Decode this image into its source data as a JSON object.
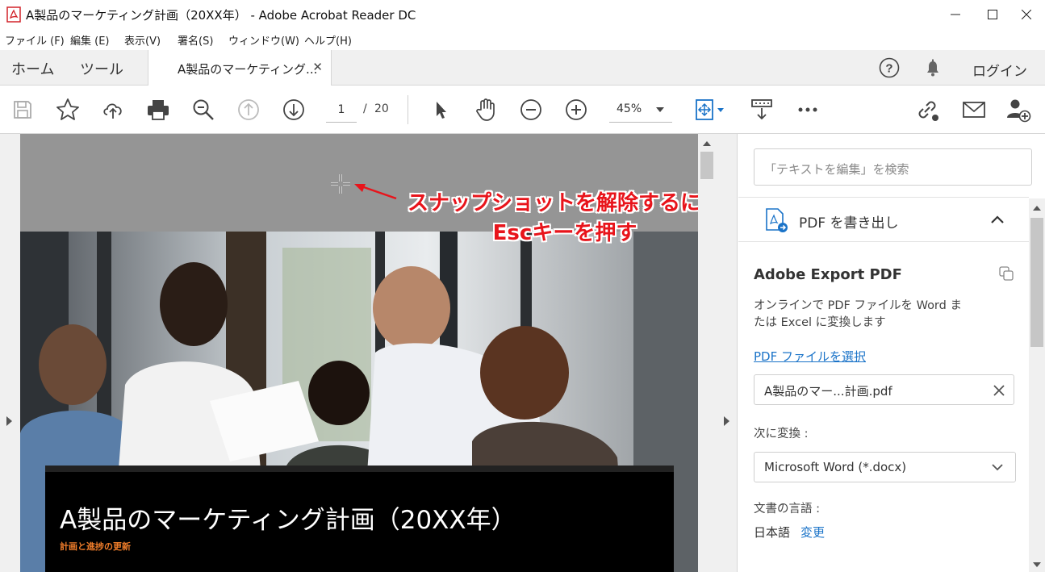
{
  "window": {
    "title": "A製品のマーケティング計画（20XX年） - Adobe Acrobat Reader DC"
  },
  "menu": {
    "items": [
      "ファイル (F)",
      "編集 (E)",
      "表示(V)",
      "署名(S)",
      "ウィンドウ(W)",
      "ヘルプ(H)"
    ]
  },
  "tabs": {
    "home": "ホーム",
    "tools": "ツール",
    "document": "A製品のマーケティング...",
    "login": "ログイン"
  },
  "toolbar": {
    "page_current": "1",
    "page_sep": "/",
    "page_total": "20",
    "zoom": "45%"
  },
  "annotation": {
    "line1": "スナップショットを解除するには",
    "line2": "Escキーを押す",
    "color": "#e8141b"
  },
  "document": {
    "title": "A製品のマーケティング計画（20XX年）",
    "subtitle": "計画と進捗の更新",
    "subtitle_color": "#f07d2a"
  },
  "panel": {
    "search_placeholder": "「テキストを編集」を検索",
    "export_section": "PDF を書き出し",
    "heading": "Adobe Export PDF",
    "description_line1": "オンラインで PDF ファイルを Word ま",
    "description_line2": "たは Excel に変換します",
    "select_link": "PDF ファイルを選択",
    "selected_file": "A製品のマー...計画.pdf",
    "convert_label": "次に変換 :",
    "convert_value": "Microsoft Word (*.docx)",
    "language_label": "文書の言語 :",
    "language_value": "日本語",
    "language_change": "変更",
    "link_color": "#1a73c8"
  }
}
